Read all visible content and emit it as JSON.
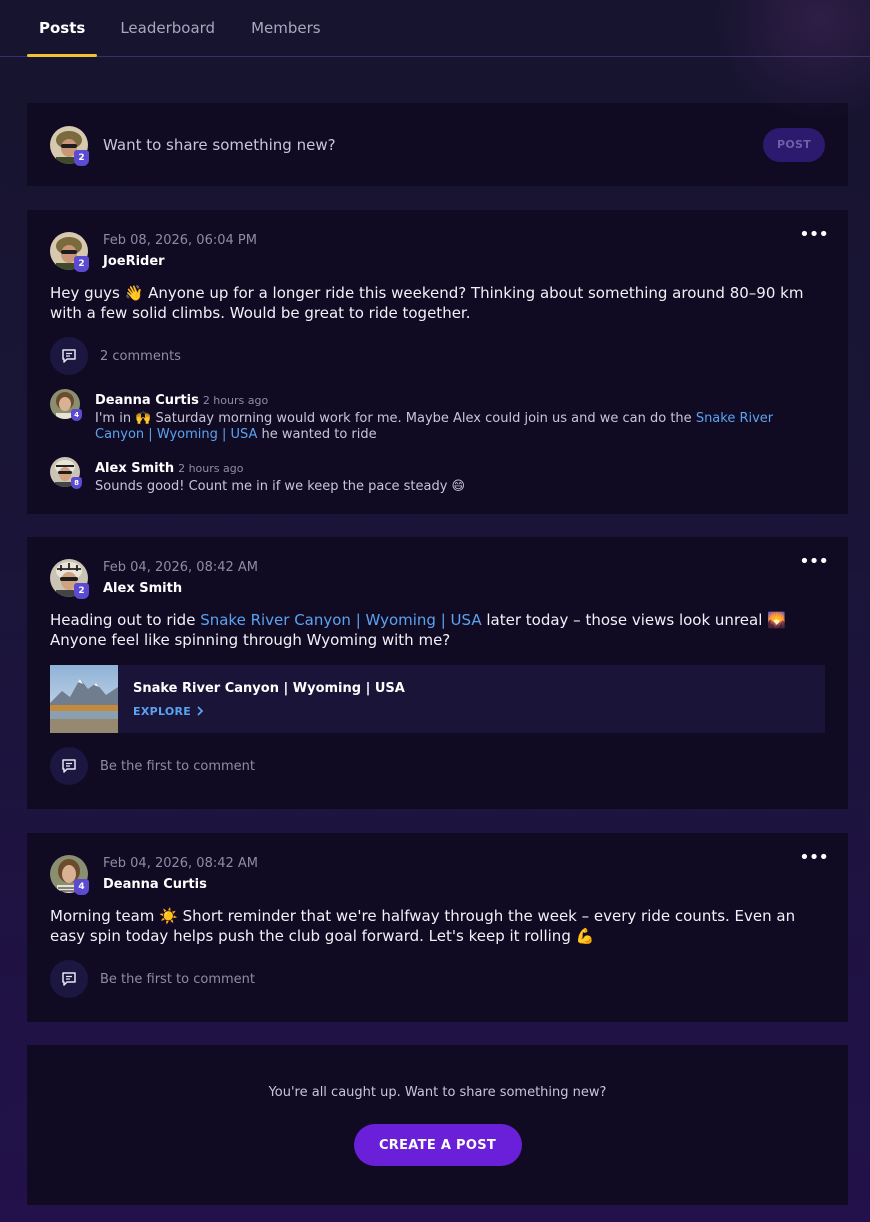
{
  "tabs": [
    {
      "label": "Posts",
      "active": true
    },
    {
      "label": "Leaderboard",
      "active": false
    },
    {
      "label": "Members",
      "active": false
    }
  ],
  "composer": {
    "level": "2",
    "prompt": "Want to share something new?",
    "post_label": "POST"
  },
  "posts": [
    {
      "date": "Feb 08, 2026, 06:04 PM",
      "author": "JoeRider",
      "level": "2",
      "body_line1": "Hey guys 👋 Anyone up for a longer ride this weekend? Thinking about something around 80–90 km",
      "body_line2": "with a few solid climbs. Would be great to ride together.",
      "comments_label": "2 comments",
      "comments": [
        {
          "name": "Deanna Curtis",
          "level": "4",
          "time": "2 hours ago",
          "text_before": "I'm in 🙌 Saturday morning would work for me. Maybe Alex could join us and we can do the ",
          "link": "Snake River Canyon | Wyoming | USA",
          "text_after": " he wanted to ride"
        },
        {
          "name": "Alex Smith",
          "level": "8",
          "time": "2 hours ago",
          "text": "Sounds good! Count me in if we keep the pace steady 😄"
        }
      ]
    },
    {
      "date": "Feb 04, 2026, 08:42 AM",
      "author": "Alex Smith",
      "level": "2",
      "body_before": "Heading out to ride ",
      "body_link": "Snake River Canyon | Wyoming | USA",
      "body_after": " later today – those views look unreal 🌄",
      "body_line2": "Anyone feel like spinning through Wyoming with me?",
      "place": {
        "name": "Snake River Canyon | Wyoming | USA",
        "action": "EXPLORE"
      },
      "comments_label": "Be the first to comment"
    },
    {
      "date": "Feb 04, 2026, 08:42 AM",
      "author": "Deanna Curtis",
      "level": "4",
      "body_line1": "Morning team ☀️ Short reminder that we're halfway through the week – every ride counts. Even an",
      "body_line2": "easy spin today helps push the club goal forward. Let's keep it rolling 💪",
      "comments_label": "Be the first to comment"
    }
  ],
  "footer": {
    "text": "You're all caught up. Want to share something new?",
    "button": "CREATE A POST"
  },
  "colors": {
    "accent": "#6a1fd8",
    "tab_indicator": "#f1c232",
    "link": "#5aa3f0",
    "card": "#100b23",
    "level_badge": "#5b4bd1"
  }
}
